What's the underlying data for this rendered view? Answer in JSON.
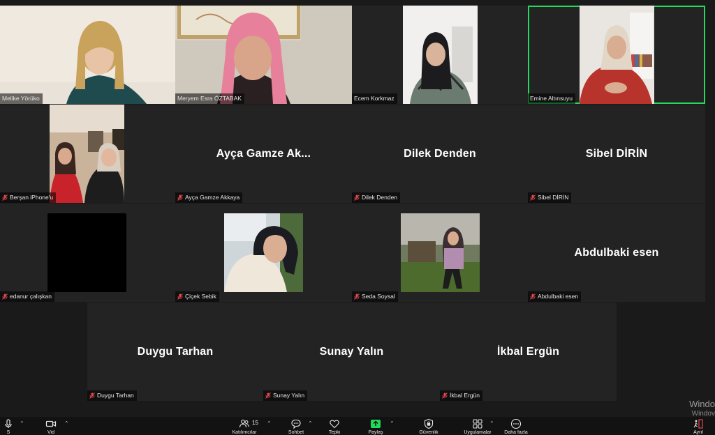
{
  "participants": {
    "melike": {
      "name": "Melike Yörüko"
    },
    "meryem": {
      "name": "Meryem Esra ÖZTABAK"
    },
    "ecem": {
      "name": "Ecem Korkmaz"
    },
    "emine": {
      "name": "Emine Altınsuyu"
    },
    "bersan": {
      "name": "Berşan iPhone'u"
    },
    "ayca": {
      "name": "Ayça Gamze Akkaya",
      "display": "Ayça Gamze Ak..."
    },
    "dilek": {
      "name": "Dilek Denden",
      "display": "Dilek Denden"
    },
    "sibel": {
      "name": "Sibel DİRİN",
      "display": "Sibel DİRİN"
    },
    "edanur": {
      "name": "edanur çalışkan"
    },
    "cicek": {
      "name": "Çiçek Sebik"
    },
    "seda": {
      "name": "Seda Soysal"
    },
    "abdulbaki": {
      "name": "Abdulbaki esen",
      "display": "Abdulbaki esen"
    },
    "duygu": {
      "name": "Duygu Tarhan",
      "display": "Duygu Tarhan"
    },
    "sunay": {
      "name": "Sunay Yalın",
      "display": "Sunay Yalın"
    },
    "ikbal": {
      "name": "İkbal Ergün",
      "display": "İkbal Ergün"
    }
  },
  "toolbar": {
    "participant_count": "15",
    "mute_label": "S",
    "video_label": "Vid",
    "participants_label": "Katılımcılar",
    "chat_label": "Sohbet",
    "react_label": "Tepki",
    "share_label": "Paylaş",
    "security_label": "Güvenlik",
    "apps_label": "Uygulamalar",
    "more_label": "Daha fazla",
    "leave_label": "Ayrıl"
  },
  "watermark": {
    "line1": "Windo",
    "line2": "Windov"
  },
  "colors": {
    "active_speaker": "#23d959",
    "muted_icon": "#e5484d",
    "share_green": "#23d959"
  }
}
